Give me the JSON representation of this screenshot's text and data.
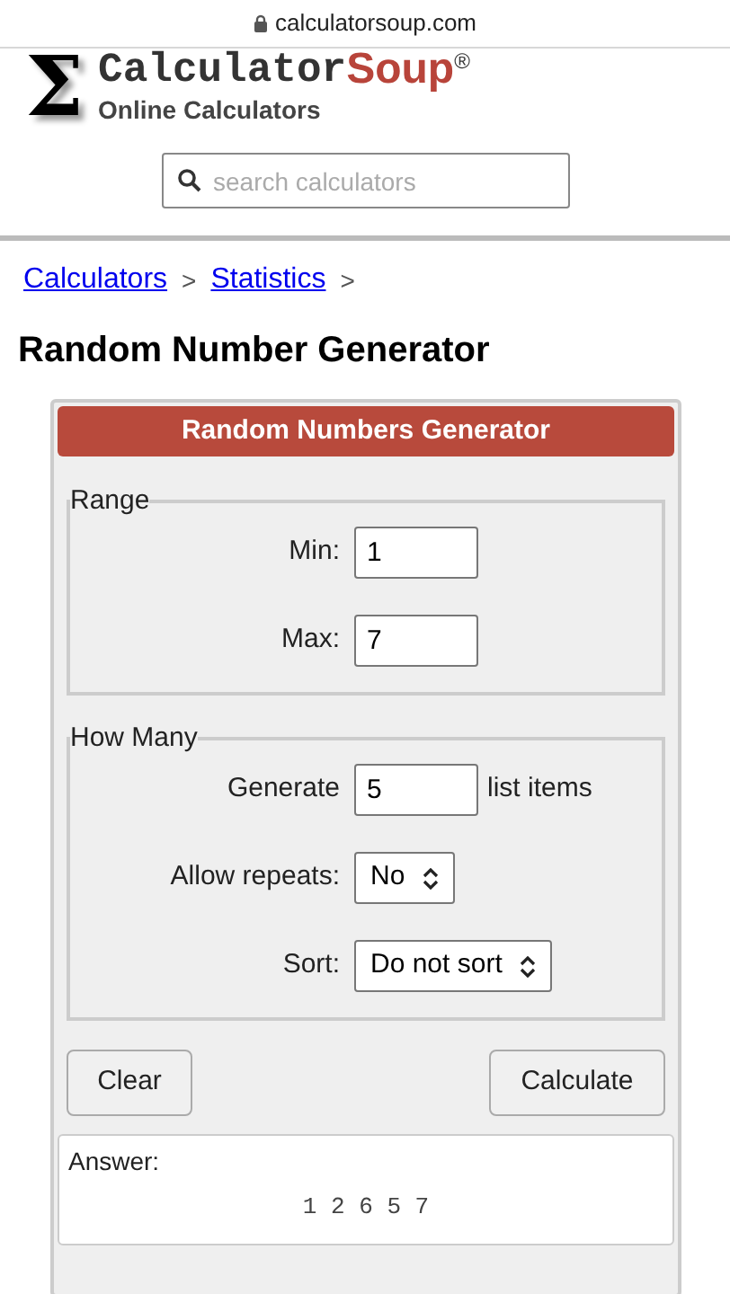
{
  "browser": {
    "url": "calculatorsoup.com"
  },
  "logo": {
    "symbol": "Σ",
    "name_start": "Calculator",
    "name_end": "Soup",
    "mark": "®",
    "tagline": "Online Calculators"
  },
  "search": {
    "placeholder": "search calculators"
  },
  "breadcrumbs": [
    {
      "label": "Calculators",
      "separator": ">"
    },
    {
      "label": "Statistics",
      "separator": ">"
    }
  ],
  "page_title": "Random Number Generator",
  "calculator": {
    "header": "Random Numbers Generator",
    "fieldsets": [
      {
        "legend": "Range",
        "rows": [
          {
            "kind": "input",
            "label": "Min:",
            "value": "1"
          },
          {
            "kind": "input",
            "label": "Max:",
            "value": "7"
          }
        ]
      },
      {
        "legend": "How Many",
        "rows": [
          {
            "kind": "input",
            "label": "Generate",
            "value": "5",
            "suffix": "list items"
          },
          {
            "kind": "select",
            "label": "Allow repeats:",
            "value": "No"
          },
          {
            "kind": "select",
            "label": "Sort:",
            "value": "Do not sort"
          }
        ]
      }
    ],
    "buttons": [
      "Clear",
      "Calculate"
    ],
    "answer": {
      "label": "Answer:",
      "value": "1 2 6 5 7"
    }
  }
}
